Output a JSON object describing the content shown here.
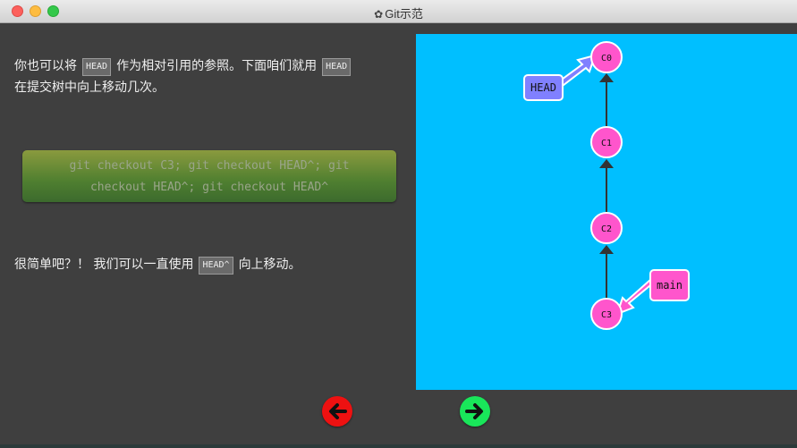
{
  "window": {
    "title": "Git示范",
    "title_icon": "gear-icon"
  },
  "intro": {
    "part1": "你也可以将",
    "code1": "HEAD",
    "part2": "作为相对引用的参照。下面咱们就用",
    "code2": "HEAD",
    "part3": "在提交树中向上移动几次。"
  },
  "command": {
    "line1": "git checkout C3; git checkout HEAD^; git",
    "line2": "checkout HEAD^; git checkout HEAD^"
  },
  "outro": {
    "part1": "很简单吧？！ 我们可以一直使用",
    "code": "HEAD^",
    "part2": "向上移动。"
  },
  "graph": {
    "background": "#00bfff",
    "commit_color": "#ff55cc",
    "head_color": "#8080ff",
    "branch_color": "#ff55cc",
    "commits": [
      "C0",
      "C1",
      "C2",
      "C3"
    ],
    "head_label": "HEAD",
    "head_target": "C0",
    "branch_label": "main",
    "branch_target": "C3"
  },
  "nav": {
    "back_icon": "arrow-left-icon",
    "forward_icon": "arrow-right-icon",
    "back_color": "#ee1111",
    "forward_color": "#19e65a"
  }
}
